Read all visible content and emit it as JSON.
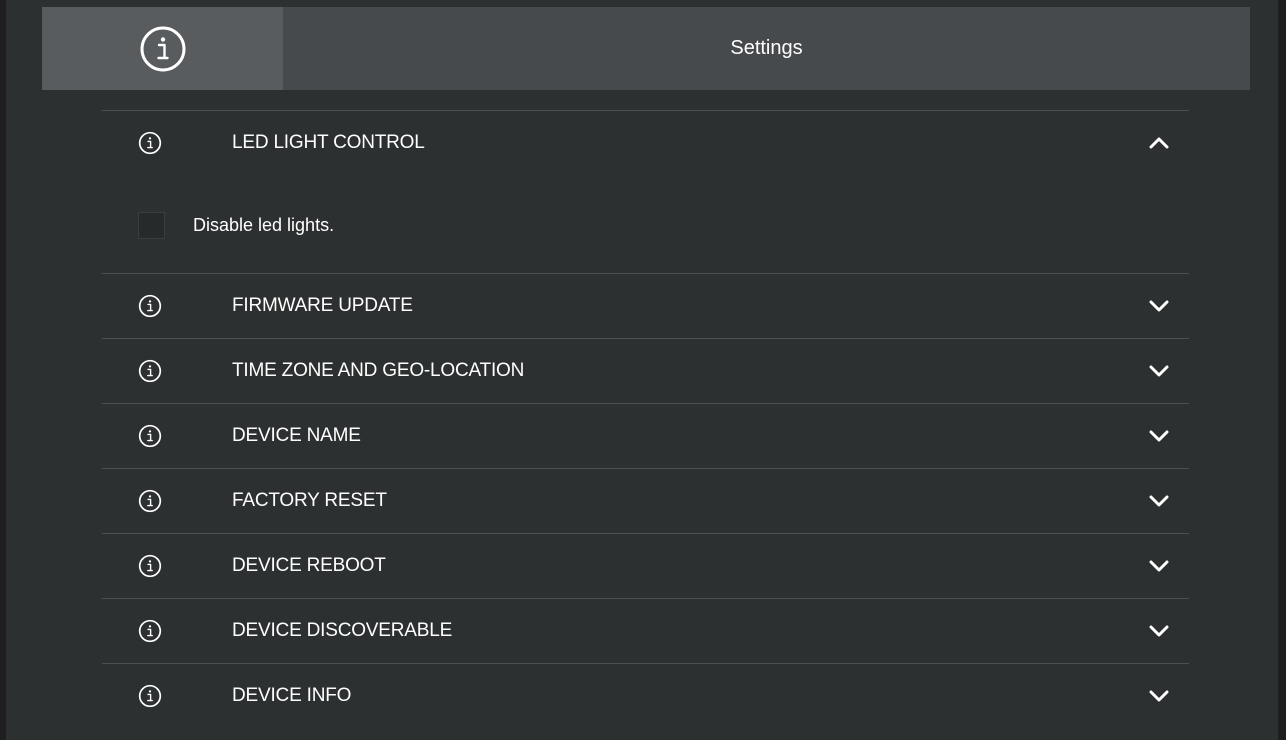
{
  "header": {
    "title": "Settings",
    "icon": "info-icon"
  },
  "sections": [
    {
      "label": "LED LIGHT CONTROL",
      "expanded": true,
      "chevron": "chevron-up-icon",
      "content": {
        "checkbox_label": "Disable led lights.",
        "checked": false
      }
    },
    {
      "label": "FIRMWARE UPDATE",
      "expanded": false,
      "chevron": "chevron-down-icon"
    },
    {
      "label": "TIME ZONE AND GEO-LOCATION",
      "expanded": false,
      "chevron": "chevron-down-icon"
    },
    {
      "label": "DEVICE NAME",
      "expanded": false,
      "chevron": "chevron-down-icon"
    },
    {
      "label": "FACTORY RESET",
      "expanded": false,
      "chevron": "chevron-down-icon"
    },
    {
      "label": "DEVICE REBOOT",
      "expanded": false,
      "chevron": "chevron-down-icon"
    },
    {
      "label": "DEVICE DISCOVERABLE",
      "expanded": false,
      "chevron": "chevron-down-icon"
    },
    {
      "label": "DEVICE INFO",
      "expanded": false,
      "chevron": "chevron-down-icon"
    }
  ],
  "colors": {
    "background": "#2c3030",
    "header": "#464a4c",
    "header_icon_cell": "#585c5e",
    "divider": "#4b5052",
    "text": "#ffffff"
  }
}
